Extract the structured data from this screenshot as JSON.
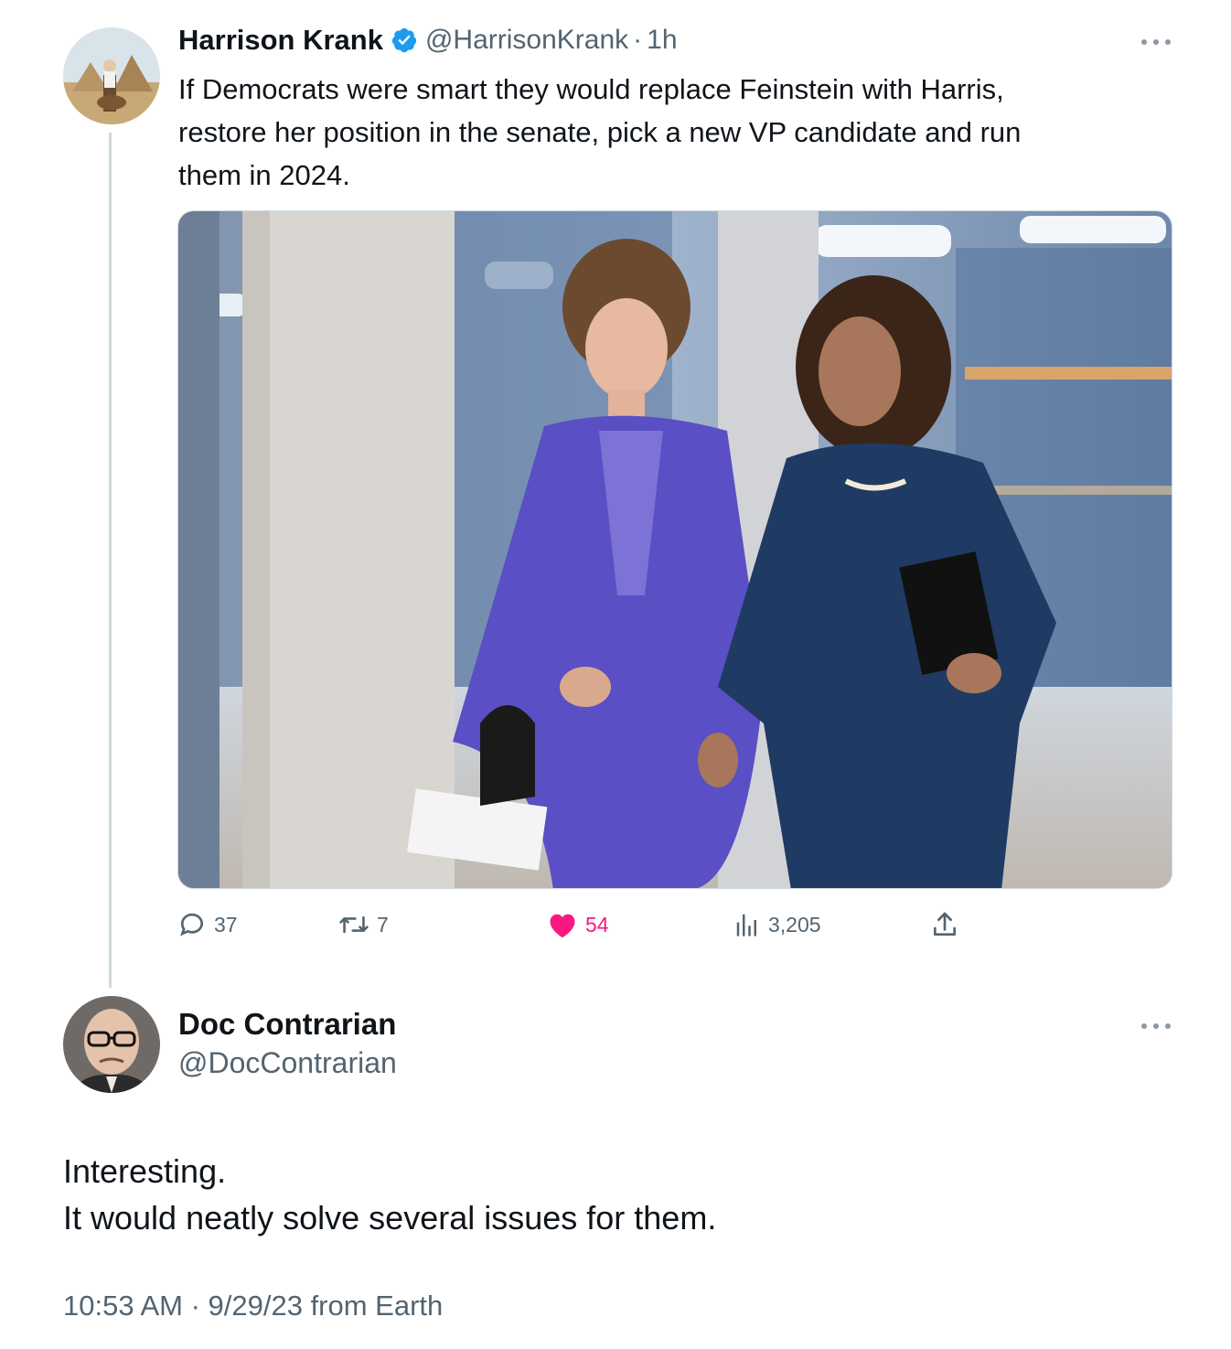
{
  "original_tweet": {
    "display_name": "Harrison Krank",
    "verified_icon": "verified-badge-icon",
    "handle": "@HarrisonKrank",
    "separator": "·",
    "time": "1h",
    "text": "If Democrats were smart they would replace Feinstein with Harris,\nrestore her position in the senate, pick a new VP candidate and run\nthem in 2024.",
    "actions": {
      "replies": "37",
      "retweets": "7",
      "likes": "54",
      "views": "3,205"
    }
  },
  "reply_tweet": {
    "display_name": "Doc Contrarian",
    "handle": "@DocContrarian",
    "text": "Interesting.\nIt would neatly solve several issues for them.",
    "timestamp": "10:53 AM · 9/29/23 from Earth"
  },
  "colors": {
    "verified_blue": "#1d9bf0",
    "like_pink": "#f91880",
    "secondary_text": "#536471",
    "thread_line": "#cfd9de"
  }
}
